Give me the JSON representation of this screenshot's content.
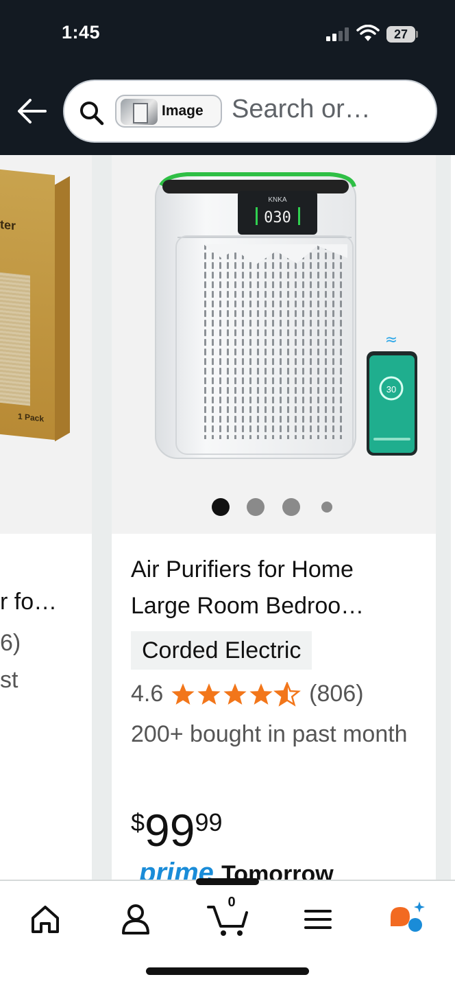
{
  "status_bar": {
    "time": "1:45",
    "battery": "27"
  },
  "search": {
    "chip_label": "Image",
    "placeholder": "Search or…"
  },
  "left_card": {
    "box_texts": [
      "ter",
      "1 Pack"
    ],
    "title_fragment": "r fo…",
    "reviews_fragment": "6)",
    "bought_fragment": "st"
  },
  "product": {
    "display_readout": "030",
    "brand_label": "KNKA",
    "phone_readout": "30",
    "image_dots": 4,
    "title": "Air Purifiers for Home Large Room Bedroo…",
    "tag": "Corded Electric",
    "rating": "4.6",
    "rating_value": 4.6,
    "review_count": "(806)",
    "bought": "200+ bought in past month",
    "price_symbol": "$",
    "price_whole": "99",
    "price_fraction": "99",
    "prime_label": "prime",
    "delivery": "Tomorrow"
  },
  "nav": {
    "cart_count": "0",
    "items": [
      "home-icon",
      "account-icon",
      "cart-icon",
      "menu-icon",
      "rufus-icon"
    ]
  },
  "colors": {
    "header_bg": "#131a22",
    "star": "#f2761a",
    "prime": "#1a8cd8"
  }
}
